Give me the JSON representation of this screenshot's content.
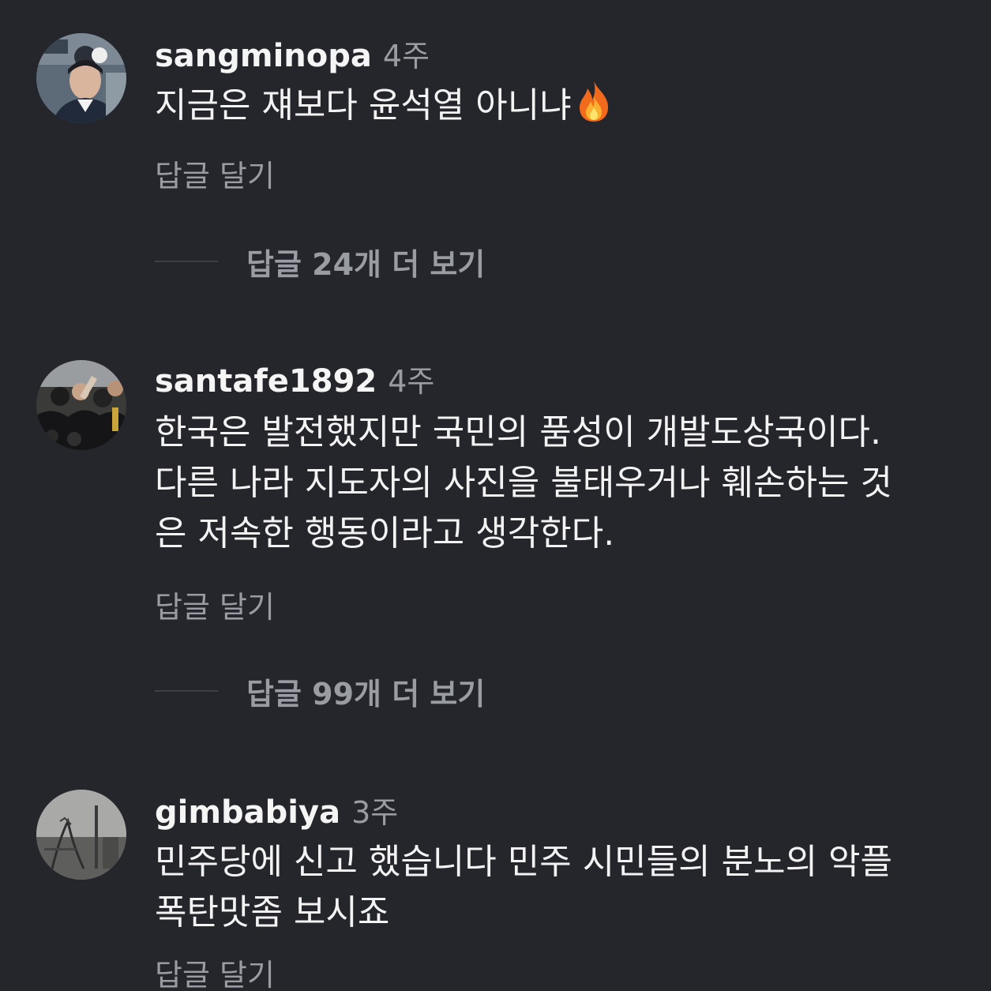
{
  "comments": [
    {
      "username": "sangminopa",
      "time": "4주",
      "lines": [
        "지금은 쟤보다 윤석열 아니냐"
      ],
      "emoji": "fire-icon",
      "reply_label": "답글 달기",
      "more_replies": "답글 24개 더 보기"
    },
    {
      "username": "santafe1892",
      "time": "4주",
      "lines": [
        "한국은 발전했지만 국민의 품성이 개발도상국이다.",
        "다른 나라 지도자의 사진을 불태우거나 훼손하는 것",
        "은 저속한 행동이라고 생각한다."
      ],
      "reply_label": "답글 달기",
      "more_replies": "답글 99개 더 보기"
    },
    {
      "username": "gimbabiya",
      "time": "3주",
      "lines": [
        "민주당에 신고 했습니다 민주 시민들의 분노의 악플",
        "폭탄맛좀 보시죠"
      ],
      "reply_label": "답글 달기"
    }
  ],
  "colors": {
    "background": "#24262b",
    "primary_text": "#f3f3f3",
    "secondary_text": "#9a9ca3",
    "divider": "#3c3f45"
  }
}
